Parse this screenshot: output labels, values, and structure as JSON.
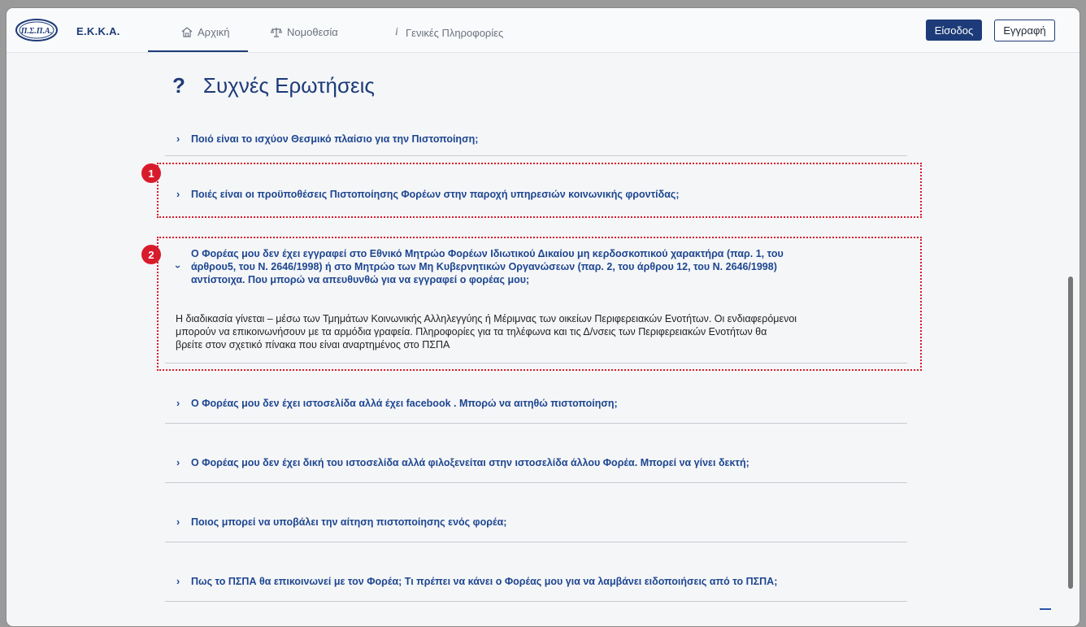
{
  "header": {
    "logo_text": "Π.Σ.Π.Α.",
    "brand": "Ε.Κ.Κ.Α.",
    "tabs": [
      {
        "label": "Αρχική",
        "icon": "home-icon",
        "active": true
      },
      {
        "label": "Νομοθεσία",
        "icon": "scales-icon",
        "active": false
      },
      {
        "label": "Γενικές Πληροφορίες",
        "icon": "info-icon",
        "active": false
      }
    ],
    "login_label": "Είσοδος",
    "register_label": "Εγγραφή"
  },
  "faq": {
    "title_mark": "?",
    "title": "Συχνές Ερωτήσεις",
    "items": [
      {
        "question": "Ποιό είναι το ισχύον Θεσμικό πλαίσιο για την Πιστοποίηση;"
      },
      {
        "question": "Ποιές είναι οι προϋποθέσεις Πιστοποίησης Φορέων στην παροχή υπηρεσιών κοινωνικής φροντίδας;",
        "badge": "1"
      },
      {
        "question_lines": [
          "Ο Φορέας μου δεν έχει εγγραφεί στο Εθνικό Μητρώο Φορέων Ιδιωτικού Δικαίου μη κερδοσκοπικού χαρακτήρα (παρ. 1, του",
          "άρθρου5, του Ν. 2646/1998) ή στο Μητρώο των Μη Κυβερνητικών Οργανώσεων (παρ. 2, του άρθρου 12, του Ν. 2646/1998)",
          "αντίστοιχα. Που μπορώ να απευθυνθώ για να εγγραφεί ο φορέας μου;"
        ],
        "badge": "2",
        "answer_lines": [
          "Η διαδικασία γίνεται – μέσω των Τμημάτων Κοινωνικής Αλληλεγγύης ή Μέριμνας των οικείων Περιφερειακών Ενοτήτων. Οι ενδιαφερόμενοι",
          "μπορούν να επικοινωνήσουν με τα αρμόδια γραφεία. Πληροφορίες για τα τηλέφωνα και τις Δ/νσεις των Περιφερειακών Ενοτήτων θα",
          "βρείτε στον σχετικό πίνακα που είναι αναρτημένος στο ΠΣΠΑ"
        ]
      },
      {
        "question": "Ο Φορέας μου δεν έχει ιστοσελίδα αλλά έχει facebook . Μπορώ να αιτηθώ πιστοποίηση;"
      },
      {
        "question": "Ο Φορέας μου δεν έχει δική του ιστοσελίδα αλλά φιλοξενείται στην ιστοσελίδα άλλου Φορέα. Μπορεί να γίνει δεκτή;"
      },
      {
        "question": "Ποιος μπορεί να υποβάλει την αίτηση πιστοποίησης ενός φορέα;"
      },
      {
        "question": "Πως το ΠΣΠΑ θα επικοινωνεί με τον Φορέα; Τι πρέπει να κάνει ο Φορέας μου για να λαμβάνει ειδοποιήσεις από το ΠΣΠΑ;"
      }
    ]
  },
  "colors": {
    "brand": "#1d3b78",
    "question": "#1d4690",
    "highlight": "#d81b2b"
  }
}
